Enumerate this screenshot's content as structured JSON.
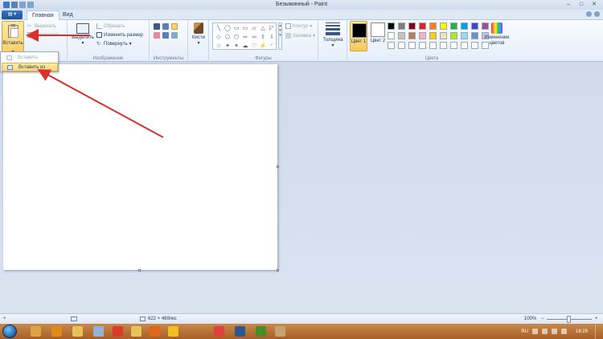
{
  "window": {
    "title": "Безымянный - Paint"
  },
  "tabs": [
    {
      "label": "Главная",
      "active": true
    },
    {
      "label": "Вид",
      "active": false
    }
  ],
  "ribbon": {
    "clipboard": {
      "paste_label": "Вставить",
      "cut_label": "Вырезать",
      "copy_label": "Копировать"
    },
    "image": {
      "group_label": "Изображение",
      "select_label": "Выделить",
      "crop_label": "Обрезать",
      "resize_label": "Изменить размер",
      "rotate_label": "Повернуть"
    },
    "tools": {
      "group_label": "Инструменты",
      "brushes_label": "Кисти"
    },
    "shapes": {
      "group_label": "Фигуры",
      "outline_label": "Контур",
      "fill_label": "Заливка",
      "symbols": [
        "╲",
        "◯",
        "▭",
        "▭",
        "▱",
        "△",
        "◸",
        "◇",
        "⬠",
        "⬡",
        "⇨",
        "⇦",
        "⇧",
        "⇩",
        "☆",
        "✦",
        "✶",
        "☁",
        "♡",
        "⚡",
        "◜"
      ]
    },
    "size": {
      "label": "Толщина"
    },
    "colors": {
      "group_label": "Цвета",
      "color1_label": "Цвет 1",
      "color2_label": "Цвет 2",
      "edit_label": "Изменение цветов",
      "color1": "#000000",
      "color2": "#ffffff",
      "palette": [
        "#000000",
        "#7f7f7f",
        "#880015",
        "#ed1c24",
        "#ff7f27",
        "#fff200",
        "#22b14c",
        "#00a2e8",
        "#3f48cc",
        "#a349a4",
        "#ffffff",
        "#c3c3c3",
        "#b97a57",
        "#ffaec9",
        "#ffc90e",
        "#efe4b0",
        "#b5e61d",
        "#99d9ea",
        "#7092be",
        "#c8bfe7",
        "#ffffff",
        "#ffffff",
        "#ffffff",
        "#ffffff",
        "#ffffff",
        "#ffffff",
        "#ffffff",
        "#ffffff",
        "#ffffff",
        "#ffffff"
      ]
    }
  },
  "paste_menu": {
    "items": [
      {
        "label": "Вставить",
        "enabled": false
      },
      {
        "label": "Вставить из",
        "enabled": true
      }
    ]
  },
  "statusbar": {
    "add_symbol": "+",
    "dimensions": "622 × 469пкс",
    "zoom": "100%",
    "zoom_minus": "−",
    "zoom_plus": "+"
  },
  "taskbar": {
    "lang": "RU",
    "time": "18:29",
    "apps": [
      {
        "icon": "explorer-icon",
        "color": "#d9a441"
      },
      {
        "icon": "media-player-icon",
        "color": "#e08a1c"
      },
      {
        "icon": "folder-icon",
        "color": "#e7c15a"
      },
      {
        "icon": "documents-icon",
        "color": "#8fb3d9"
      },
      {
        "icon": "chrome-icon",
        "color": "#d93a2b"
      },
      {
        "icon": "explorer-window-icon",
        "color": "#e7c15a"
      },
      {
        "icon": "firefox-icon",
        "color": "#e0661a"
      },
      {
        "icon": "yandex-icon",
        "color": "#f0c020"
      },
      {
        "icon": "yandex-browser-icon",
        "color": "#e04040"
      },
      {
        "icon": "word-icon",
        "color": "#2b5797"
      },
      {
        "icon": "chrome-active-icon",
        "color": "#4a8c2a"
      },
      {
        "icon": "paint-icon",
        "color": "#c9a070"
      }
    ]
  }
}
